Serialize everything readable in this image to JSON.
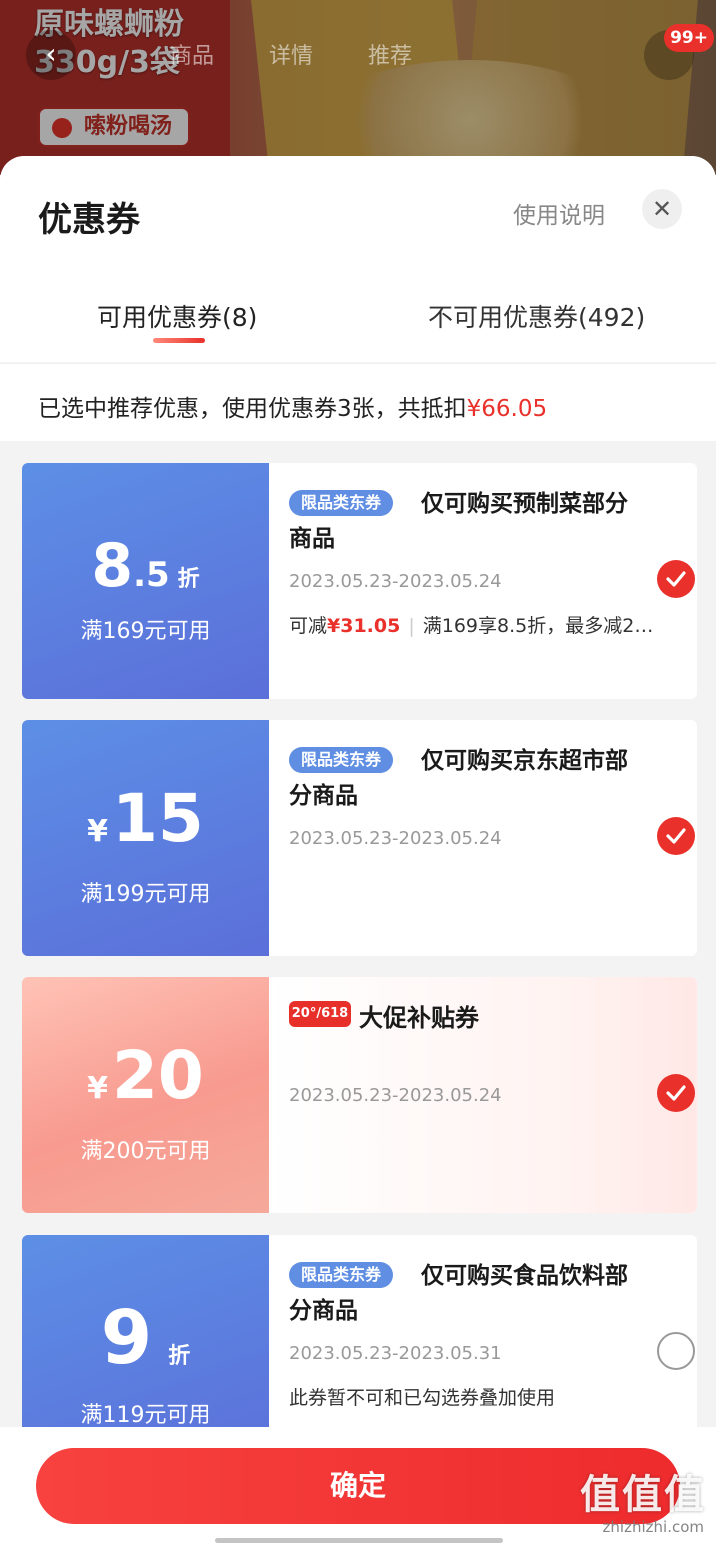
{
  "background": {
    "product_title_line1": "原味螺蛳粉",
    "product_title_line2": "330g/3袋",
    "tag": "嗦粉喝汤",
    "tabs": [
      "商品",
      "详情",
      "推荐"
    ],
    "cart_badge": "99+"
  },
  "sheet": {
    "title": "优惠券",
    "usage_link": "使用说明",
    "close_icon": "close-icon",
    "tabs": [
      {
        "label": "可用优惠券(8)",
        "active": true
      },
      {
        "label": "不可用优惠券(492)",
        "active": false
      }
    ],
    "summary_text": "已选中推荐优惠，使用优惠券3张，共抵扣",
    "summary_amount": "¥66.05"
  },
  "coupons": [
    {
      "value_main": "8",
      "value_dec": ".5",
      "value_unit": "折",
      "condition": "满169元可用",
      "tag": "限品类东券",
      "title": "仅可购买预制菜部分商品",
      "date": "2023.05.23-2023.05.24",
      "note_prefix": "可减",
      "note_amount": "¥31.05",
      "note_rest": "满169享8.5折，最多减2…",
      "checked": true
    },
    {
      "value_prefix": "¥",
      "value_main": "15",
      "condition": "满199元可用",
      "tag": "限品类东券",
      "title": "仅可购买京东超市部分商品",
      "date": "2023.05.23-2023.05.24",
      "checked": true
    },
    {
      "value_prefix": "¥",
      "value_main": "20",
      "condition": "满200元可用",
      "tag": "20°/618",
      "title": "大促补贴券",
      "date": "2023.05.23-2023.05.24",
      "checked": true
    },
    {
      "value_main": "9",
      "value_unit": "折",
      "condition": "满119元可用",
      "tag": "限品类东券",
      "title": "仅可购买食品饮料部分商品",
      "date": "2023.05.23-2023.05.31",
      "note": "此券暂不可和已勾选券叠加使用",
      "checked": false
    }
  ],
  "footer": {
    "confirm_label": "确定",
    "watermark": "值值值",
    "watermark_sub": "zhizhizhi.com"
  },
  "colors": {
    "accent_red": "#e9302a",
    "coupon_blue": "#5d8fe6",
    "promo_pink": "#f89a8f"
  }
}
